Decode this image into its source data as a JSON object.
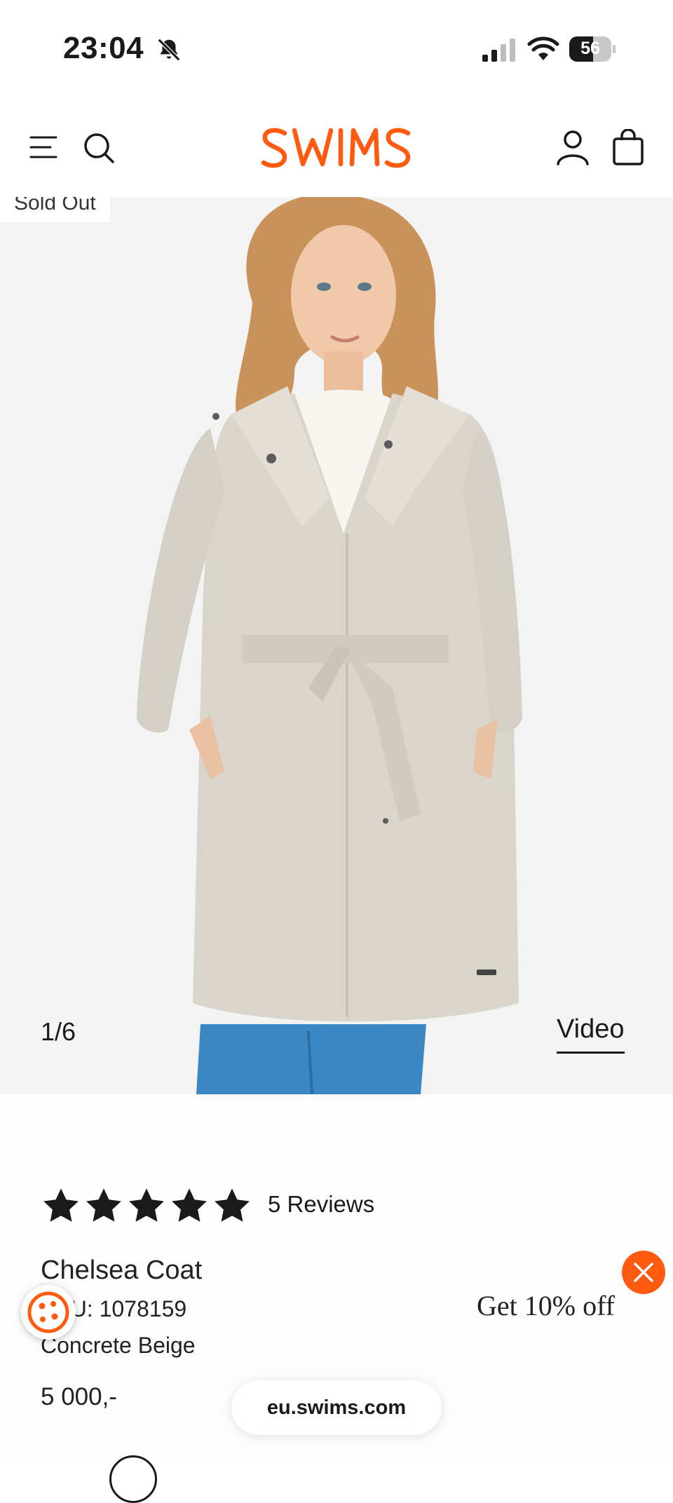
{
  "status_bar": {
    "time": "23:04",
    "battery_level": "56",
    "icons": [
      "bell-slash-icon",
      "signal-icon",
      "wifi-icon",
      "battery-icon"
    ]
  },
  "header": {
    "brand": "SWIMS",
    "brand_color": "#ff5a10",
    "icons": [
      "menu-icon",
      "search-icon",
      "account-icon",
      "bag-icon"
    ]
  },
  "gallery": {
    "badge": "Sold Out",
    "counter": "1/6",
    "video_label": "Video"
  },
  "product": {
    "rating": 5,
    "reviews_label": "5 Reviews",
    "title": "Chelsea Coat",
    "sku_label": "SKU: 1078159",
    "color_label": "Concrete Beige",
    "price": "5 000,-"
  },
  "promo": {
    "text": "Get 10% off",
    "close_color": "#ff5a10"
  },
  "browser": {
    "url": "eu.swims.com"
  }
}
